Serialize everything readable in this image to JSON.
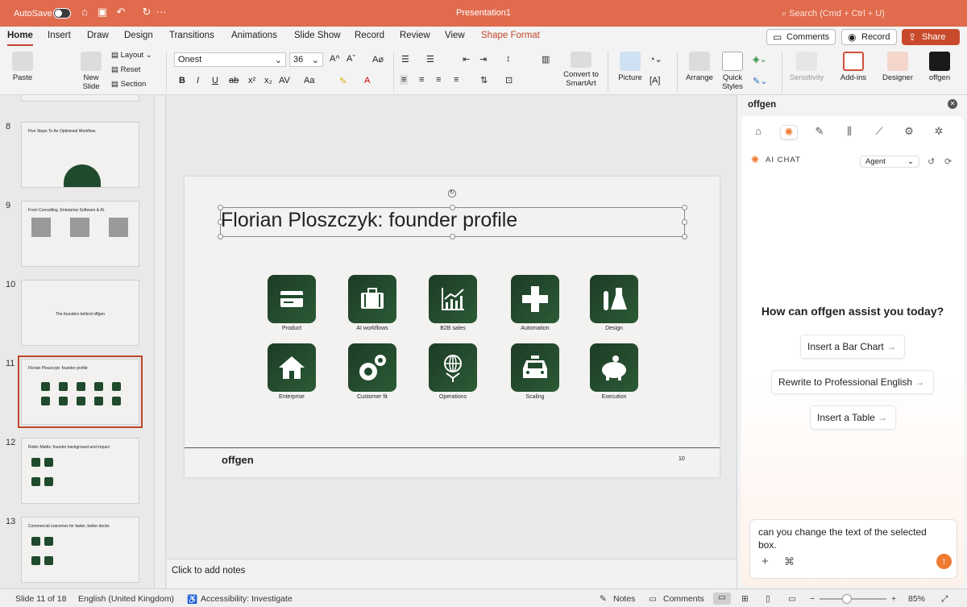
{
  "titlebar": {
    "autosave": "AutoSave",
    "doc_title": "Presentation1",
    "search": "Search (Cmd + Ctrl + U)"
  },
  "tabs": [
    "Home",
    "Insert",
    "Draw",
    "Design",
    "Transitions",
    "Animations",
    "Slide Show",
    "Record",
    "Review",
    "View",
    "Shape Format"
  ],
  "actions": {
    "comments": "Comments",
    "record": "Record",
    "share": "Share"
  },
  "ribbon": {
    "paste": "Paste",
    "new_slide": "New Slide",
    "layout": "Layout",
    "reset": "Reset",
    "section": "Section",
    "font": "Onest",
    "size": "36",
    "convert": "Convert to SmartArt",
    "picture": "Picture",
    "arrange": "Arrange",
    "quick_styles": "Quick Styles",
    "sensitivity": "Sensitivity",
    "addins": "Add-ins",
    "designer": "Designer",
    "offgen": "offgen"
  },
  "thumbnails": [
    {
      "num": "8",
      "title": "Five Steps To An Optimised Workflow."
    },
    {
      "num": "9",
      "title": "From Consulting, Enterprise Software & AI."
    },
    {
      "num": "10",
      "title": "The founders behind offgen"
    },
    {
      "num": "11",
      "title": "Florian Ploszczyk: founder profile"
    },
    {
      "num": "12",
      "title": "Robin Mattis: founder background and impact"
    },
    {
      "num": "13",
      "title": "Commercial outcomes for faster, better decks"
    }
  ],
  "slide": {
    "title": "Florian Ploszczyk: founder profile",
    "logo": "offgen",
    "page": "10",
    "tiles": [
      "Product",
      "AI workflows",
      "B2B sales",
      "Automation",
      "Design",
      "Enterprise",
      "Customer fit",
      "Operations",
      "Scaling",
      "Execution"
    ]
  },
  "notes": "Click to add notes",
  "panel": {
    "title": "offgen",
    "ai_chat": "AI CHAT",
    "mode": "Agent",
    "heading": "How can offgen assist you today?",
    "suggestions": [
      "Insert a Bar Chart",
      "Rewrite to Professional English",
      "Insert a Table"
    ],
    "input": "can you change the text of the selected box."
  },
  "status": {
    "slide": "Slide 11 of 18",
    "lang": "English (United Kingdom)",
    "access": "Accessibility: Investigate",
    "notes": "Notes",
    "comments": "Comments",
    "zoom": "85%"
  },
  "colors": {
    "titlebar": "#e06b4d",
    "accent": "#c0472b",
    "tile": "#1f4a2c",
    "offgen_orange": "#f07a2f"
  }
}
